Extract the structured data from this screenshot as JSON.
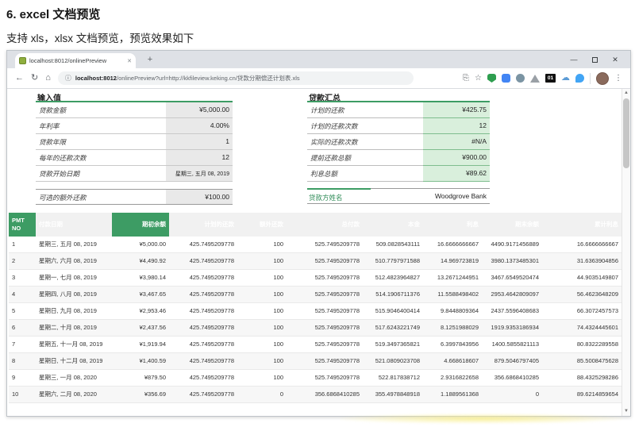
{
  "doc": {
    "heading": "6. excel 文档预览",
    "subheading": "支持 xls，xlsx 文档预览，预览效果如下"
  },
  "browser": {
    "tab": {
      "title": "localhost:8012/onlinePreview",
      "close_glyph": "✕"
    },
    "new_tab_label": "+",
    "window_controls": {
      "minimize": "—",
      "close": "✕"
    },
    "nav": {
      "back": "←",
      "reload": "↻",
      "home": "⌂"
    },
    "address": {
      "info_glyph": "ⓘ",
      "host": "localhost:8012",
      "path": "/onlinePreview?url=http://kkfileview.keking.cn/贷款分期偿还计划表.xls"
    },
    "actions": {
      "star": "☆",
      "badge_01": "01",
      "cloud_glyph": "☁",
      "menu": "⋮"
    }
  },
  "sheet": {
    "input": {
      "title": "输入值",
      "rows": [
        {
          "label": "贷款金额",
          "value": "¥5,000.00"
        },
        {
          "label": "年利率",
          "value": "4.00%"
        },
        {
          "label": "贷款年限",
          "value": "1"
        },
        {
          "label": "每年的还款次数",
          "value": "12"
        },
        {
          "label": "贷款开始日期",
          "value": "星期三, 五月 08, 2019"
        }
      ]
    },
    "summary": {
      "title": "贷款汇总",
      "rows": [
        {
          "label": "计划的还款",
          "value": "¥425.75"
        },
        {
          "label": "计划的还款次数",
          "value": "12"
        },
        {
          "label": "实际的还款次数",
          "value": "#N/A"
        },
        {
          "label": "提前还款总额",
          "value": "¥900.00"
        },
        {
          "label": "利息总额",
          "value": "¥89.62"
        }
      ]
    },
    "extra": {
      "label": "可选的额外还款",
      "value": "¥100.00"
    },
    "lender": {
      "label": "贷款方姓名",
      "value": "Woodgrove Bank"
    },
    "schedule": {
      "headers": [
        "PMT NO",
        "付款日期",
        "期初余额",
        "计划的还款",
        "额外还款",
        "总付款",
        "本金",
        "利息",
        "期末余额",
        "累计利息"
      ],
      "green_header_cols": [
        0,
        2
      ],
      "rows": [
        [
          "1",
          "星期三, 五月 08, 2019",
          "¥5,000.00",
          "425.7495209778",
          "100",
          "525.7495209778",
          "509.0828543111",
          "16.6666666667",
          "4490.9171456889",
          "16.6666666667"
        ],
        [
          "2",
          "星期六, 六月 08, 2019",
          "¥4,490.92",
          "425.7495209778",
          "100",
          "525.7495209778",
          "510.7797971588",
          "14.969723819",
          "3980.1373485301",
          "31.6363904856"
        ],
        [
          "3",
          "星期一, 七月 08, 2019",
          "¥3,980.14",
          "425.7495209778",
          "100",
          "525.7495209778",
          "512.4823964827",
          "13.2671244951",
          "3467.6549520474",
          "44.9035149807"
        ],
        [
          "4",
          "星期四, 八月 08, 2019",
          "¥3,467.65",
          "425.7495209778",
          "100",
          "525.7495209778",
          "514.1906711376",
          "11.5588498402",
          "2953.4642809097",
          "56.4623648209"
        ],
        [
          "5",
          "星期日, 九月 08, 2019",
          "¥2,953.46",
          "425.7495209778",
          "100",
          "525.7495209778",
          "515.9046400414",
          "9.8448809364",
          "2437.5596408683",
          "66.3072457573"
        ],
        [
          "6",
          "星期二, 十月 08, 2019",
          "¥2,437.56",
          "425.7495209778",
          "100",
          "525.7495209778",
          "517.6243221749",
          "8.1251988029",
          "1919.9353186934",
          "74.4324445601"
        ],
        [
          "7",
          "星期五, 十一月 08, 2019",
          "¥1,919.94",
          "425.7495209778",
          "100",
          "525.7495209778",
          "519.3497365821",
          "6.3997843956",
          "1400.5855821113",
          "80.8322289558"
        ],
        [
          "8",
          "星期日, 十二月 08, 2019",
          "¥1,400.59",
          "425.7495209778",
          "100",
          "525.7495209778",
          "521.0809023708",
          "4.668618607",
          "879.5046797405",
          "85.5008475628"
        ],
        [
          "9",
          "星期三, 一月 08, 2020",
          "¥879.50",
          "425.7495209778",
          "100",
          "525.7495209778",
          "522.817838712",
          "2.9316822658",
          "356.6868410285",
          "88.4325298286"
        ],
        [
          "10",
          "星期六, 二月 08, 2020",
          "¥356.69",
          "425.7495209778",
          "0",
          "356.6868410285",
          "355.4978848918",
          "1.1889561368",
          "0",
          "89.6214859654"
        ]
      ]
    }
  },
  "colors": {
    "accent_green": "#3d9c64",
    "light_green": "#d9efdc",
    "gray_cell": "#e9e9e9"
  }
}
